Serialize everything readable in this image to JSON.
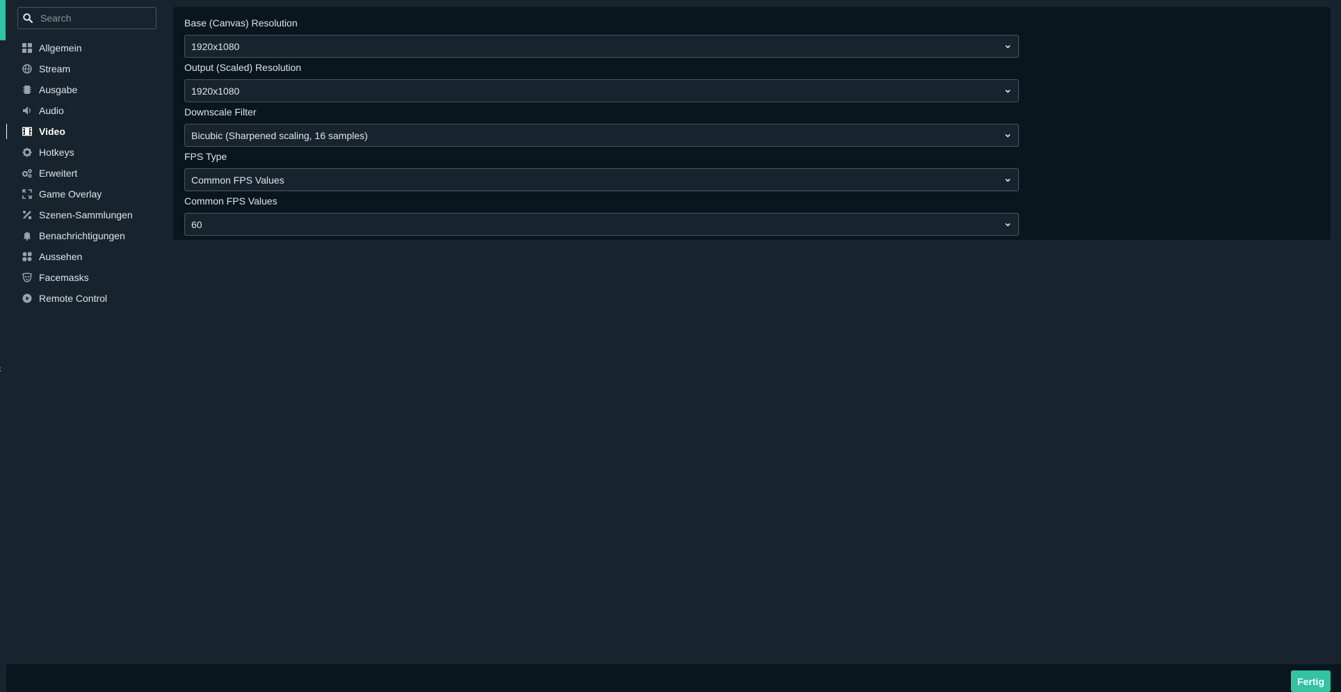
{
  "search": {
    "placeholder": "Search"
  },
  "sidebar": {
    "items": [
      {
        "label": "Allgemein",
        "icon": "grid-icon"
      },
      {
        "label": "Stream",
        "icon": "globe-icon"
      },
      {
        "label": "Ausgabe",
        "icon": "chip-icon"
      },
      {
        "label": "Audio",
        "icon": "speaker-icon"
      },
      {
        "label": "Video",
        "icon": "film-icon",
        "active": true
      },
      {
        "label": "Hotkeys",
        "icon": "gear-icon"
      },
      {
        "label": "Erweitert",
        "icon": "gears-icon"
      },
      {
        "label": "Game Overlay",
        "icon": "expand-icon"
      },
      {
        "label": "Szenen-Sammlungen",
        "icon": "tools-icon"
      },
      {
        "label": "Benachrichtigungen",
        "icon": "bell-icon"
      },
      {
        "label": "Aussehen",
        "icon": "palette-icon"
      },
      {
        "label": "Facemasks",
        "icon": "mask-icon"
      },
      {
        "label": "Remote Control",
        "icon": "play-circle-icon"
      }
    ]
  },
  "video": {
    "fields": [
      {
        "label": "Base (Canvas) Resolution",
        "value": "1920x1080"
      },
      {
        "label": "Output (Scaled) Resolution",
        "value": "1920x1080"
      },
      {
        "label": "Downscale Filter",
        "value": "Bicubic (Sharpened scaling, 16 samples)"
      },
      {
        "label": "FPS Type",
        "value": "Common FPS Values"
      },
      {
        "label": "Common FPS Values",
        "value": "60"
      }
    ]
  },
  "footer": {
    "done_label": "Fertig"
  },
  "colors": {
    "accent": "#31c3a2",
    "background": "#17242d",
    "panel": "#09161d"
  }
}
